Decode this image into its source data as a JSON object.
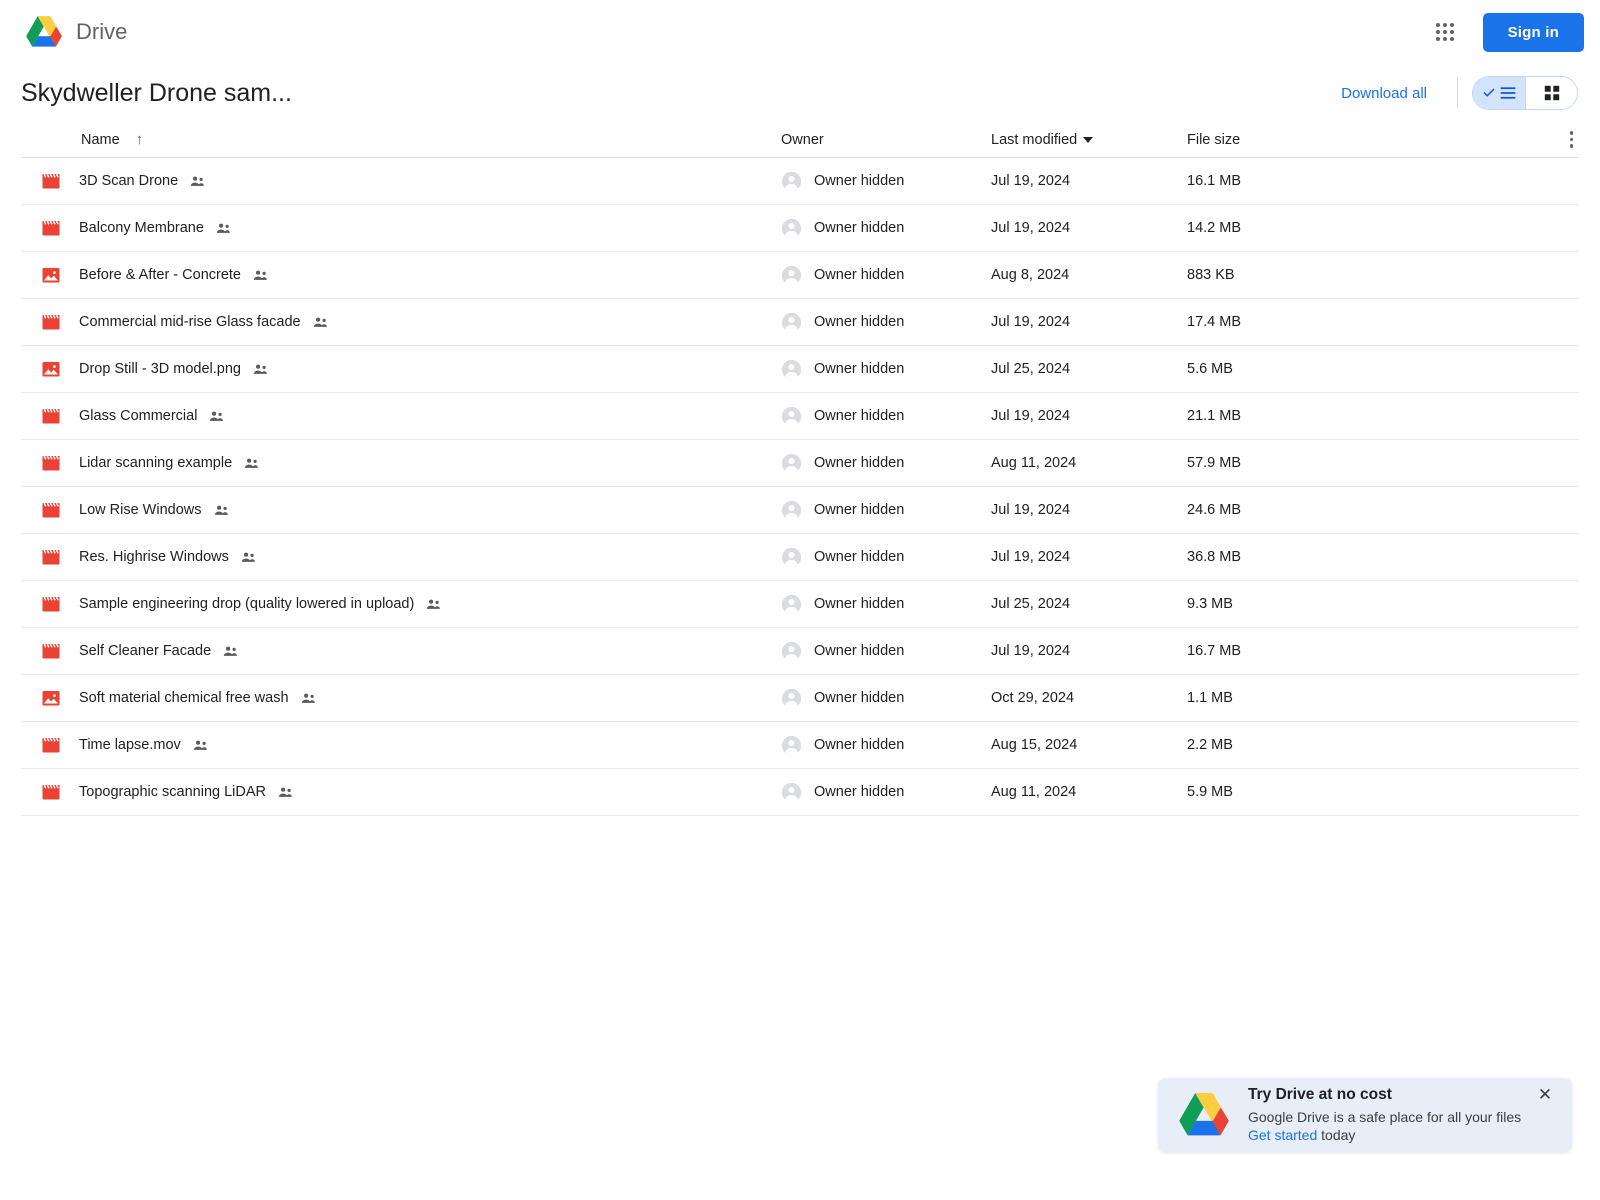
{
  "topbar": {
    "brand_name": "Drive",
    "logo_icon": "drive-logo",
    "apps_icon": "apps-grid-icon",
    "signin_label": "Sign in"
  },
  "subheader": {
    "folder_title": "Skydweller Drone sam...",
    "download_all_label": "Download all",
    "list_view_icon": "list-view-icon",
    "grid_view_icon": "grid-view-icon",
    "active_view": "list"
  },
  "table": {
    "columns": {
      "name": "Name",
      "owner": "Owner",
      "last_modified": "Last modified",
      "file_size": "File size"
    },
    "sort_icon": "arrow-up-icon",
    "modified_caret_icon": "caret-down-icon",
    "more_icon": "more-vertical-icon",
    "rows": [
      {
        "icon": "video-file-icon",
        "name": "3D Scan Drone",
        "shared": "shared-people-icon",
        "owner": "Owner hidden",
        "modified": "Jul 19, 2024",
        "size": "16.1 MB"
      },
      {
        "icon": "video-file-icon",
        "name": "Balcony Membrane",
        "shared": "shared-people-icon",
        "owner": "Owner hidden",
        "modified": "Jul 19, 2024",
        "size": "14.2 MB"
      },
      {
        "icon": "image-file-icon",
        "name": "Before & After - Concrete",
        "shared": "shared-people-icon",
        "owner": "Owner hidden",
        "modified": "Aug 8, 2024",
        "size": "883 KB"
      },
      {
        "icon": "video-file-icon",
        "name": "Commercial mid-rise Glass facade",
        "shared": "shared-people-icon",
        "owner": "Owner hidden",
        "modified": "Jul 19, 2024",
        "size": "17.4 MB"
      },
      {
        "icon": "image-file-icon",
        "name": "Drop Still - 3D model.png",
        "shared": "shared-people-icon",
        "owner": "Owner hidden",
        "modified": "Jul 25, 2024",
        "size": "5.6 MB"
      },
      {
        "icon": "video-file-icon",
        "name": "Glass Commercial",
        "shared": "shared-people-icon",
        "owner": "Owner hidden",
        "modified": "Jul 19, 2024",
        "size": "21.1 MB"
      },
      {
        "icon": "video-file-icon",
        "name": "Lidar scanning example",
        "shared": "shared-people-icon",
        "owner": "Owner hidden",
        "modified": "Aug 11, 2024",
        "size": "57.9 MB"
      },
      {
        "icon": "video-file-icon",
        "name": "Low Rise Windows",
        "shared": "shared-people-icon",
        "owner": "Owner hidden",
        "modified": "Jul 19, 2024",
        "size": "24.6 MB"
      },
      {
        "icon": "video-file-icon",
        "name": "Res. Highrise Windows",
        "shared": "shared-people-icon",
        "owner": "Owner hidden",
        "modified": "Jul 19, 2024",
        "size": "36.8 MB"
      },
      {
        "icon": "video-file-icon",
        "name": "Sample engineering drop (quality lowered in upload)",
        "shared": "shared-people-icon",
        "owner": "Owner hidden",
        "modified": "Jul 25, 2024",
        "size": "9.3 MB"
      },
      {
        "icon": "video-file-icon",
        "name": "Self Cleaner Facade",
        "shared": "shared-people-icon",
        "owner": "Owner hidden",
        "modified": "Jul 19, 2024",
        "size": "16.7 MB"
      },
      {
        "icon": "image-file-icon",
        "name": "Soft material chemical free wash",
        "shared": "shared-people-icon",
        "owner": "Owner hidden",
        "modified": "Oct 29, 2024",
        "size": "1.1 MB"
      },
      {
        "icon": "video-file-icon",
        "name": "Time lapse.mov",
        "shared": "shared-people-icon",
        "owner": "Owner hidden",
        "modified": "Aug 15, 2024",
        "size": "2.2 MB"
      },
      {
        "icon": "video-file-icon",
        "name": "Topographic scanning LiDAR",
        "shared": "shared-people-icon",
        "owner": "Owner hidden",
        "modified": "Aug 11, 2024",
        "size": "5.9 MB"
      }
    ]
  },
  "promo": {
    "logo_icon": "drive-logo",
    "title": "Try Drive at no cost",
    "subtitle": "Google Drive is a safe place for all your files",
    "link_label": "Get started",
    "link_suffix": " today",
    "close_icon": "close-icon",
    "close_glyph": "✕"
  },
  "colors": {
    "accent_blue": "#1a73e8",
    "file_red": "#ea4335",
    "toggle_active": "#d3e3fd",
    "promo_bg": "#e8eef7"
  }
}
